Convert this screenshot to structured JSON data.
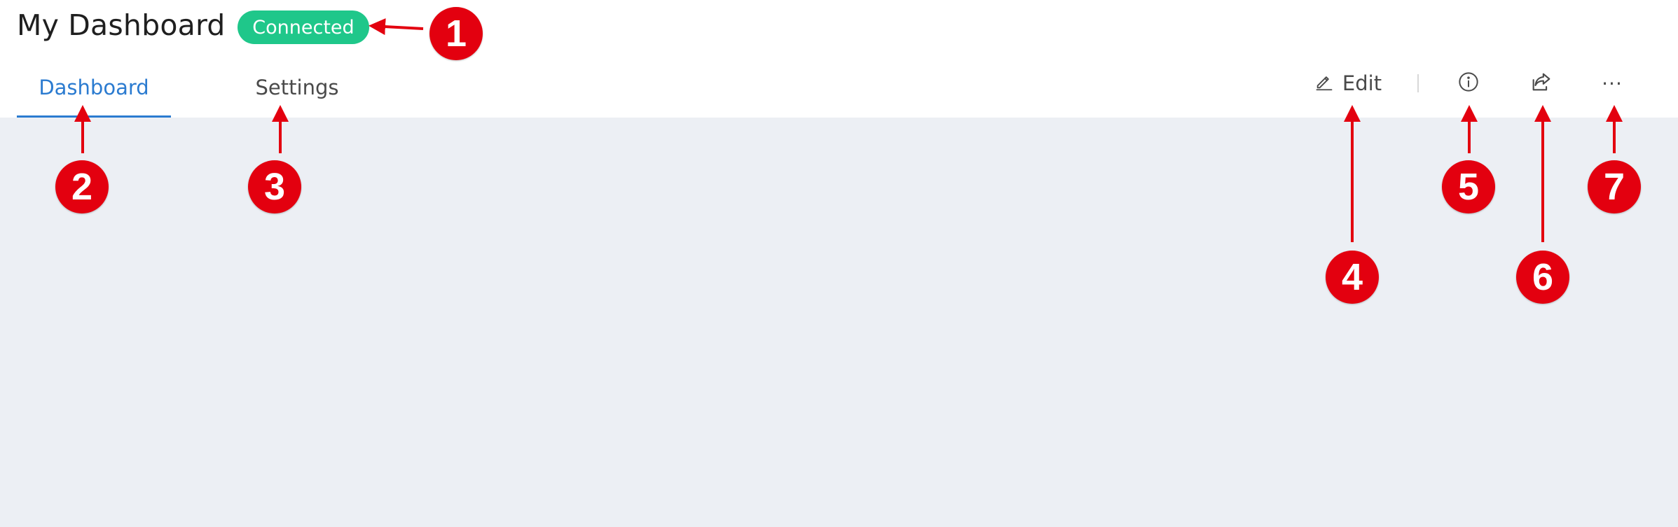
{
  "header": {
    "title": "My Dashboard",
    "status": "Connected"
  },
  "tabs": [
    {
      "label": "Dashboard",
      "active": true
    },
    {
      "label": "Settings",
      "active": false
    }
  ],
  "toolbar": {
    "edit_label": "Edit",
    "more_glyph": "···"
  },
  "callouts": [
    "1",
    "2",
    "3",
    "4",
    "5",
    "6",
    "7"
  ],
  "colors": {
    "accent": "#2b7bd0",
    "status": "#1fc78a",
    "content_bg": "#eceff4",
    "callout": "#e3000f"
  },
  "icons": {
    "edit": "pencil-icon",
    "info": "info-circle-icon",
    "share": "share-icon",
    "more": "more-horizontal-icon"
  }
}
